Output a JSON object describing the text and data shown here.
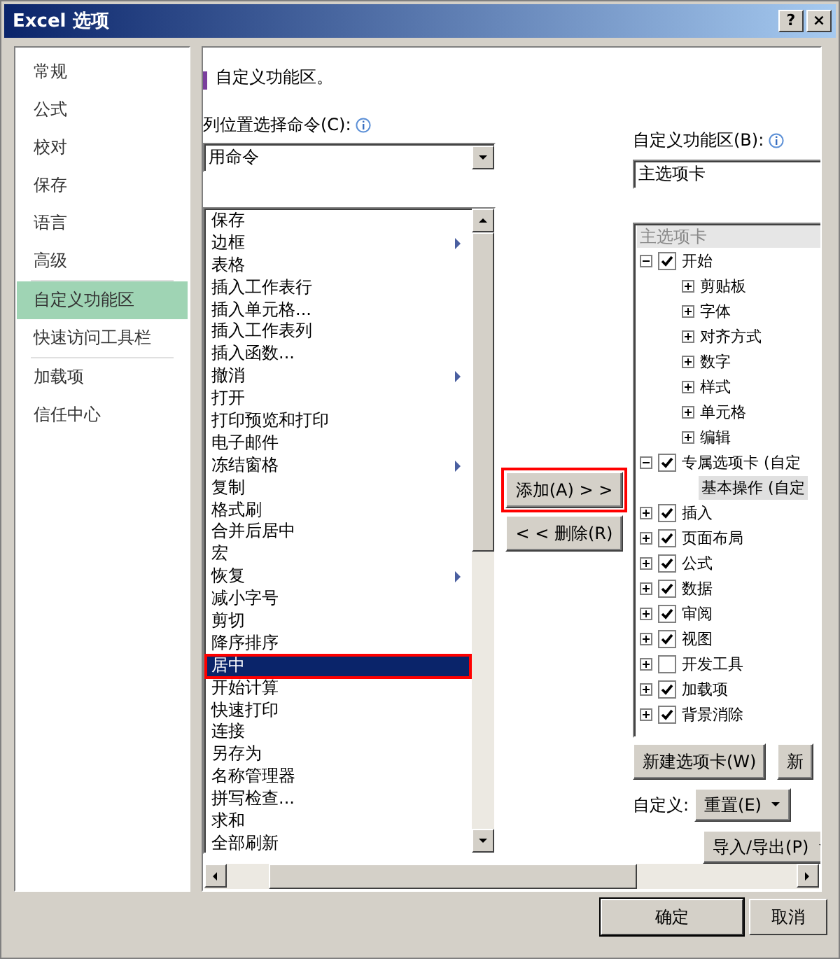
{
  "window": {
    "title": "Excel 选项",
    "help": "?",
    "close": "×"
  },
  "sidebar": {
    "items": [
      {
        "label": "常规",
        "selected": false,
        "divider_after": false
      },
      {
        "label": "公式",
        "selected": false,
        "divider_after": false
      },
      {
        "label": "校对",
        "selected": false,
        "divider_after": false
      },
      {
        "label": "保存",
        "selected": false,
        "divider_after": false
      },
      {
        "label": "语言",
        "selected": false,
        "divider_after": false
      },
      {
        "label": "高级",
        "selected": false,
        "divider_after": true
      },
      {
        "label": "自定义功能区",
        "selected": true,
        "divider_after": false
      },
      {
        "label": "快速访问工具栏",
        "selected": false,
        "divider_after": true
      },
      {
        "label": "加载项",
        "selected": false,
        "divider_after": false
      },
      {
        "label": "信任中心",
        "selected": false,
        "divider_after": false
      }
    ]
  },
  "heading": "自定义功能区。",
  "commands": {
    "label": "列位置选择命令(C):",
    "dropdown_value": "用命令",
    "items": [
      {
        "label": "保存",
        "selected": false,
        "submenu": false
      },
      {
        "label": "边框",
        "selected": false,
        "submenu": true
      },
      {
        "label": "表格",
        "selected": false,
        "submenu": false
      },
      {
        "label": "插入工作表行",
        "selected": false,
        "submenu": false
      },
      {
        "label": "插入单元格...",
        "selected": false,
        "submenu": false
      },
      {
        "label": "插入工作表列",
        "selected": false,
        "submenu": false
      },
      {
        "label": "插入函数...",
        "selected": false,
        "submenu": false
      },
      {
        "label": "撤消",
        "selected": false,
        "submenu": true
      },
      {
        "label": "打开",
        "selected": false,
        "submenu": false
      },
      {
        "label": "打印预览和打印",
        "selected": false,
        "submenu": false
      },
      {
        "label": "电子邮件",
        "selected": false,
        "submenu": false
      },
      {
        "label": "冻结窗格",
        "selected": false,
        "submenu": true
      },
      {
        "label": "复制",
        "selected": false,
        "submenu": false
      },
      {
        "label": "格式刷",
        "selected": false,
        "submenu": false
      },
      {
        "label": "合并后居中",
        "selected": false,
        "submenu": false
      },
      {
        "label": "宏",
        "selected": false,
        "submenu": false
      },
      {
        "label": "恢复",
        "selected": false,
        "submenu": true
      },
      {
        "label": "减小字号",
        "selected": false,
        "submenu": false
      },
      {
        "label": "剪切",
        "selected": false,
        "submenu": false
      },
      {
        "label": "降序排序",
        "selected": false,
        "submenu": false
      },
      {
        "label": "居中",
        "selected": true,
        "submenu": false
      },
      {
        "label": "开始计算",
        "selected": false,
        "submenu": false
      },
      {
        "label": "快速打印",
        "selected": false,
        "submenu": false
      },
      {
        "label": "连接",
        "selected": false,
        "submenu": false
      },
      {
        "label": "另存为",
        "selected": false,
        "submenu": false
      },
      {
        "label": "名称管理器",
        "selected": false,
        "submenu": false
      },
      {
        "label": "拼写检查...",
        "selected": false,
        "submenu": false
      },
      {
        "label": "求和",
        "selected": false,
        "submenu": false
      },
      {
        "label": "全部刷新",
        "selected": false,
        "submenu": false
      }
    ]
  },
  "add_button": "添加(A) > >",
  "remove_button": "< < 删除(R)",
  "ribbon": {
    "label": "自定义功能区(B):",
    "dropdown_value": "主选项卡",
    "tree_header": "主选项卡",
    "tree": [
      {
        "label": "开始",
        "checked": true,
        "expanded": true,
        "selected": false,
        "children": [
          {
            "label": "剪贴板",
            "expanded": false,
            "selected": false
          },
          {
            "label": "字体",
            "expanded": false,
            "selected": false
          },
          {
            "label": "对齐方式",
            "expanded": false,
            "selected": false
          },
          {
            "label": "数字",
            "expanded": false,
            "selected": false
          },
          {
            "label": "样式",
            "expanded": false,
            "selected": false
          },
          {
            "label": "单元格",
            "expanded": false,
            "selected": false
          },
          {
            "label": "编辑",
            "expanded": false,
            "selected": false
          }
        ]
      },
      {
        "label": "专属选项卡 (自定",
        "checked": true,
        "expanded": true,
        "selected": false,
        "children": [
          {
            "label": "基本操作 (自定",
            "selected": true
          }
        ]
      },
      {
        "label": "插入",
        "checked": true,
        "expanded": false,
        "selected": false
      },
      {
        "label": "页面布局",
        "checked": true,
        "expanded": false,
        "selected": false
      },
      {
        "label": "公式",
        "checked": true,
        "expanded": false,
        "selected": false
      },
      {
        "label": "数据",
        "checked": true,
        "expanded": false,
        "selected": false
      },
      {
        "label": "审阅",
        "checked": true,
        "expanded": false,
        "selected": false
      },
      {
        "label": "视图",
        "checked": true,
        "expanded": false,
        "selected": false
      },
      {
        "label": "开发工具",
        "checked": false,
        "expanded": false,
        "selected": false
      },
      {
        "label": "加载项",
        "checked": true,
        "expanded": false,
        "selected": false
      },
      {
        "label": "背景消除",
        "checked": true,
        "expanded": false,
        "selected": false
      }
    ],
    "new_tab_button": "新建选项卡(W)",
    "new_group_button": "新",
    "customize_label": "自定义:",
    "reset_button": "重置(E)",
    "import_export_button": "导入/导出(P)"
  },
  "footer": {
    "ok": "确定",
    "cancel": "取消"
  }
}
